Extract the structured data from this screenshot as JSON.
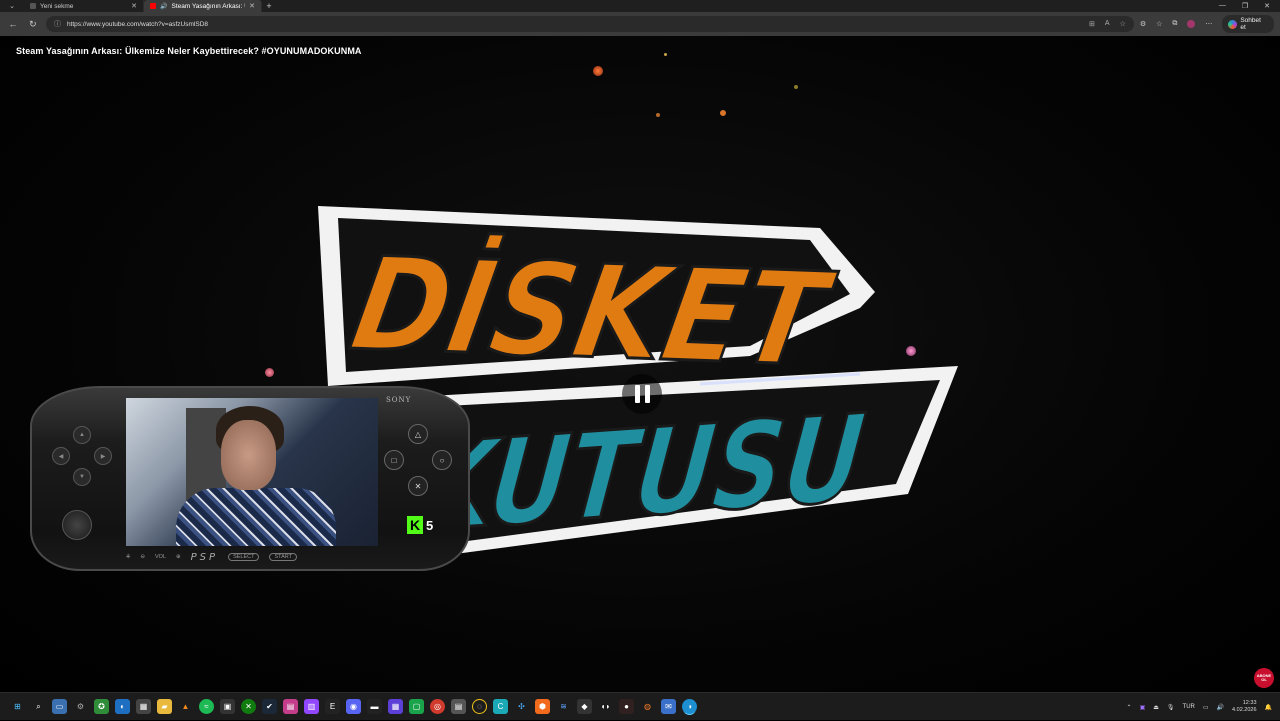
{
  "browser": {
    "tabs": [
      {
        "title": "Yeni sekme",
        "active": false
      },
      {
        "title": "Steam Yasağının Arkası: Ülk",
        "active": true
      }
    ],
    "url": "https://www.youtube.com/watch?v=asfzUsmlSD8",
    "chat_label": "Sohbet et"
  },
  "video": {
    "title": "Steam Yasağının Arkası: Ülkemize Neler Kaybettirecek? #OYUNUMADOKUNMA",
    "logo_top": "DİSKET",
    "logo_bottom": "KUTUSU",
    "state": "playing"
  },
  "overlay": {
    "brand": "SONY",
    "console": "PSP",
    "vol_label": "VOL",
    "select_label": "SELECT",
    "start_label": "START",
    "kick_letter": "K",
    "kick_number": "5",
    "subscribe": "ABONE OL"
  },
  "taskbar": {
    "language": "TUR",
    "time": "12:33",
    "date": "4.02.2026"
  },
  "colors": {
    "logo_orange": "#e07b12",
    "logo_teal": "#1f8f9f",
    "kick_green": "#53fc18",
    "youtube_red": "#ff0000"
  }
}
